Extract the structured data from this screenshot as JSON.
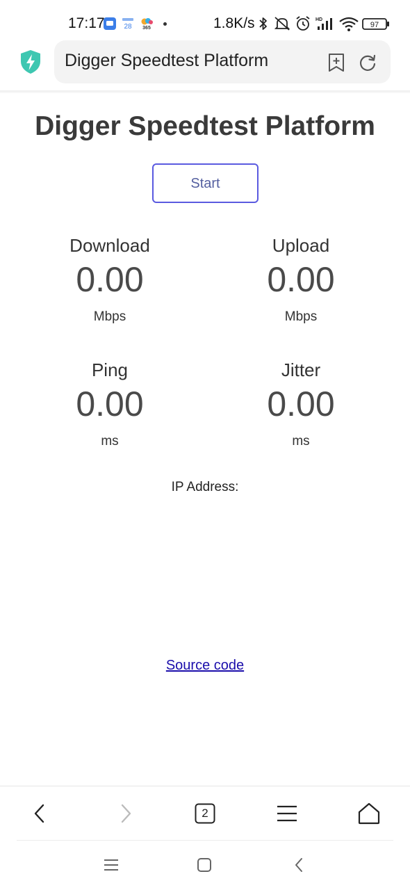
{
  "status_bar": {
    "time": "17:17",
    "net_speed": "1.8K/s",
    "battery": "97",
    "calendar_day": "28",
    "app_badge": "365"
  },
  "address_bar": {
    "url_text": "Digger Speedtest Platform"
  },
  "page": {
    "title": "Digger Speedtest Platform",
    "start_label": "Start",
    "metrics": {
      "download": {
        "label": "Download",
        "value": "0.00",
        "unit": "Mbps"
      },
      "upload": {
        "label": "Upload",
        "value": "0.00",
        "unit": "Mbps"
      },
      "ping": {
        "label": "Ping",
        "value": "0.00",
        "unit": "ms"
      },
      "jitter": {
        "label": "Jitter",
        "value": "0.00",
        "unit": "ms"
      }
    },
    "ip_label": "IP Address:",
    "source_link": "Source code"
  },
  "toolbar": {
    "tabs_count": "2"
  },
  "colors": {
    "accent": "#5a5ae0",
    "shield": "#3ec7b1",
    "link": "#1a0dab"
  },
  "icons": {
    "status_bar": [
      "app-notification-icon",
      "calendar-icon",
      "weather-icon",
      "bluetooth-icon",
      "mute-icon",
      "alarm-icon",
      "signal-icon",
      "wifi-icon",
      "battery-icon"
    ],
    "address_bar": [
      "shield-bolt-icon",
      "bookmark-add-icon",
      "reload-icon"
    ],
    "toolbar": [
      "back-icon",
      "forward-icon",
      "tabs-icon",
      "menu-icon",
      "home-icon"
    ],
    "system_nav": [
      "recent-apps-icon",
      "home-icon",
      "back-icon"
    ]
  }
}
